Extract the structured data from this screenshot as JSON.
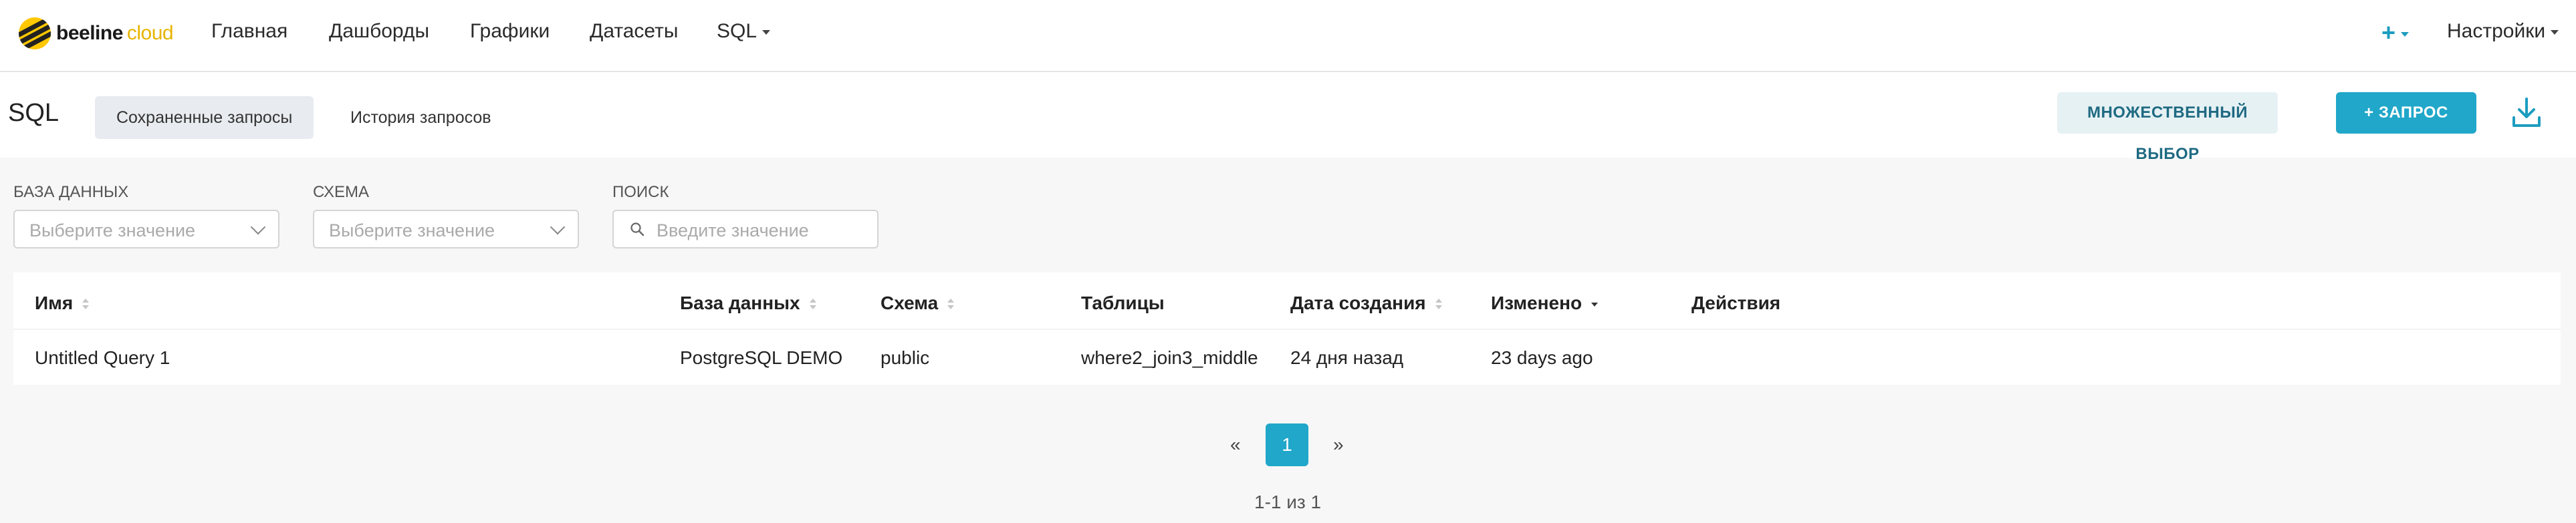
{
  "brand": {
    "name_bold": "beeline",
    "name_light": "cloud"
  },
  "nav": {
    "items": [
      {
        "label": "Главная"
      },
      {
        "label": "Дашборды"
      },
      {
        "label": "Графики"
      },
      {
        "label": "Датасеты"
      },
      {
        "label": "SQL"
      }
    ],
    "plus": "+",
    "settings": "Настройки"
  },
  "page": {
    "title": "SQL",
    "tabs": [
      {
        "label": "Сохраненные запросы"
      },
      {
        "label": "История запросов"
      }
    ],
    "bulk_select": "МНОЖЕСТВЕННЫЙ ВЫБОР",
    "new_query": "+ ЗАПРОС"
  },
  "filters": {
    "database": {
      "label": "БАЗА ДАННЫХ",
      "placeholder": "Выберите значение"
    },
    "schema": {
      "label": "СХЕМА",
      "placeholder": "Выберите значение"
    },
    "search": {
      "label": "ПОИСК",
      "placeholder": "Введите значение"
    }
  },
  "table": {
    "columns": [
      "Имя",
      "База данных",
      "Схема",
      "Таблицы",
      "Дата создания",
      "Изменено",
      "Действия"
    ],
    "rows": [
      {
        "name": "Untitled Query 1",
        "database": "PostgreSQL DEMO",
        "schema": "public",
        "tables": "where2_join3_middle",
        "created": "24 дня назад",
        "modified": "23 days ago"
      }
    ]
  },
  "pagination": {
    "prev": "«",
    "page": "1",
    "next": "»",
    "summary": "1-1 из 1"
  },
  "colors": {
    "accent": "#20a7c9",
    "accent_light": "#e6f1f4",
    "brand_yellow": "#ffc800"
  }
}
